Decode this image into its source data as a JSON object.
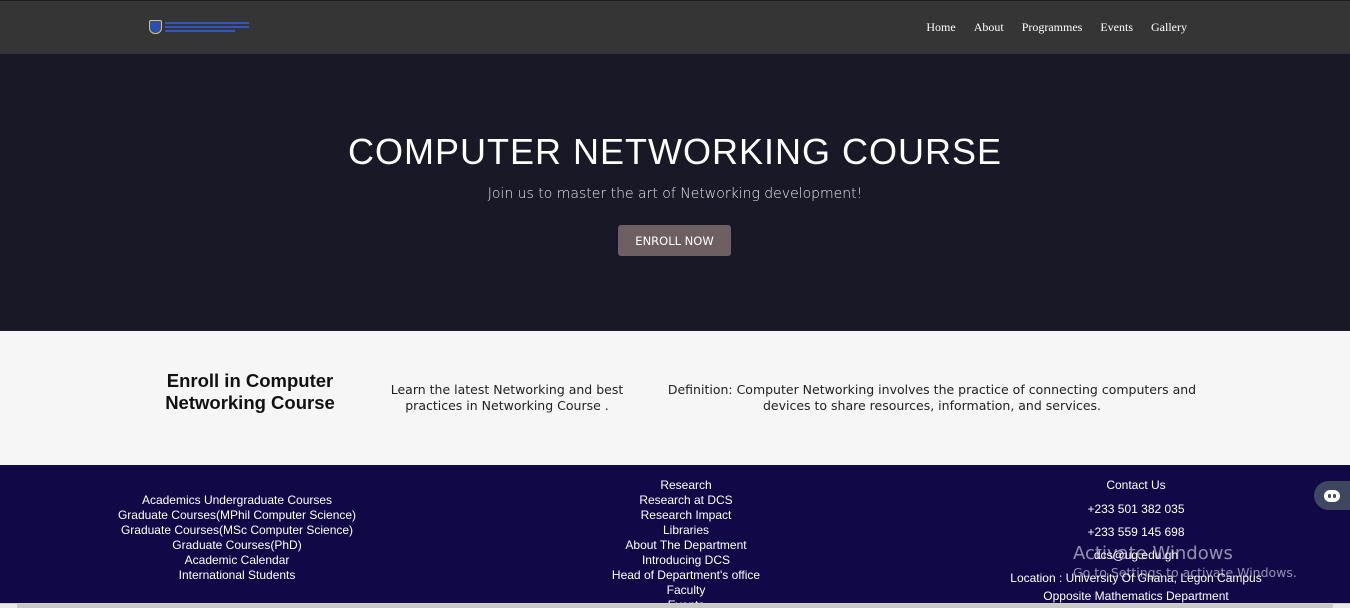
{
  "navbar": {
    "logo_alt": "Department of Computer Science",
    "links": [
      "Home",
      "About",
      "Programmes",
      "Events",
      "Gallery"
    ]
  },
  "hero": {
    "title": "COMPUTER NETWORKING COURSE",
    "subtitle": "Join us to master the art of Networking development!",
    "button": "ENROLL NOW"
  },
  "info": {
    "heading": "Enroll in Computer Networking Course",
    "text1": "Learn the latest Networking and best practices in Networking Course .",
    "text2": "Definition: Computer Networking involves the practice of connecting computers and devices to share resources, information, and services."
  },
  "footer": {
    "col1": [
      "Academics Undergraduate Courses",
      "Graduate Courses(MPhil Computer Science)",
      "Graduate Courses(MSc Computer Science)",
      "Graduate Courses(PhD)",
      "Academic Calendar",
      "International Students"
    ],
    "col2": [
      "Research",
      "Research at DCS",
      "Research Impact",
      "Libraries",
      "About The Department",
      "Introducing DCS",
      "Head of Department's office",
      "Faculty",
      "Events"
    ],
    "col3": [
      "Contact Us",
      "+233 501 382 035",
      "+233 559 145 698",
      "dcs@ug.edu.gh",
      "Location : University Of Ghana, Legon Campus",
      "Opposite Mathematics Department"
    ]
  },
  "overlay": {
    "activate_title": "Activate Windows",
    "activate_sub": "Go to Settings to activate Windows."
  },
  "colors": {
    "navbar": "#353535",
    "hero": "#181826",
    "button": "#6e5f62",
    "info": "#f6f6f6",
    "footer": "#110848"
  }
}
